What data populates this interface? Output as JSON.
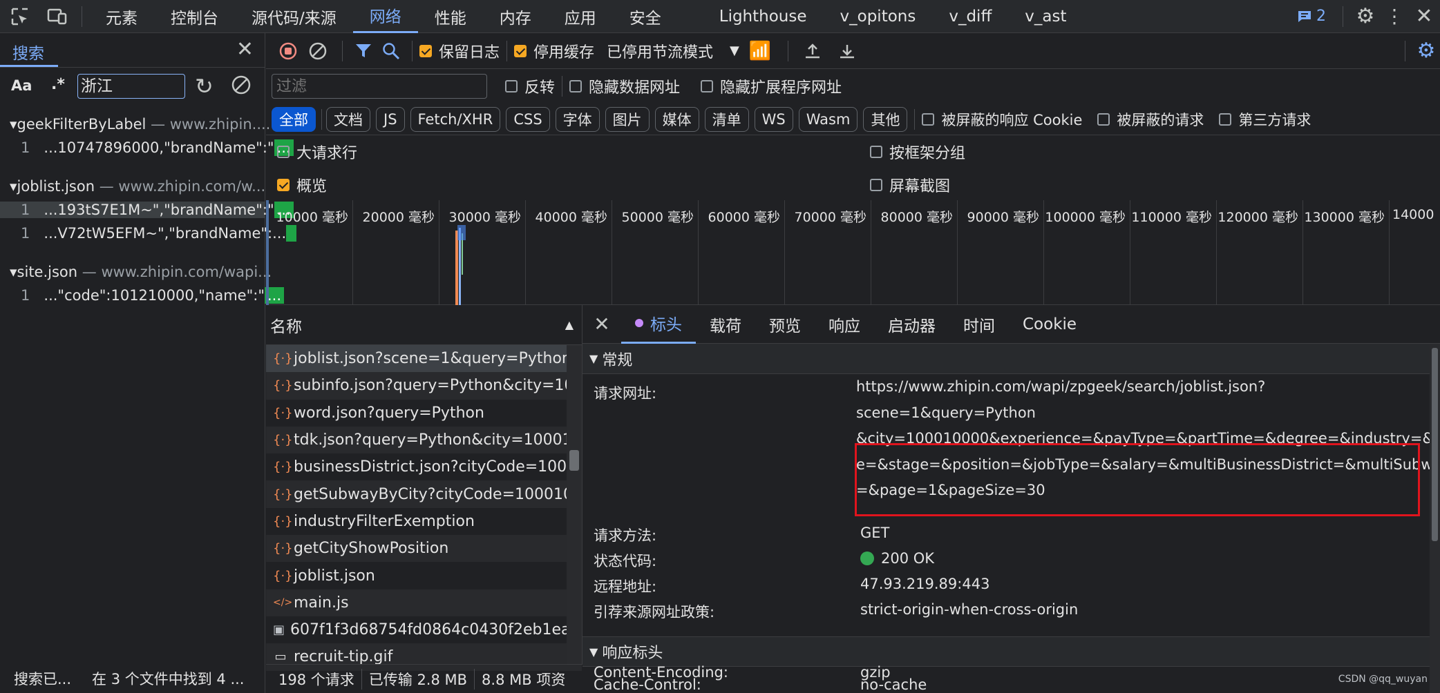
{
  "top_tabs": [
    "元素",
    "控制台",
    "源代码/来源",
    "网络",
    "性能",
    "内存",
    "应用",
    "安全",
    "Lighthouse",
    "v_opitons",
    "v_diff",
    "v_ast"
  ],
  "issues_count": "2",
  "search_panel": {
    "tab": "搜索",
    "case_label": "Aa",
    "regex_label": ".*",
    "query": "浙江",
    "results": [
      {
        "file": "geekFilterByLabel",
        "url": "— www.zhipin....",
        "lines": [
          {
            "num": "1",
            "text": "...10747896000,\"brandName\":\"",
            "hit": "..."
          }
        ]
      },
      {
        "file": "joblist.json",
        "url": "— www.zhipin.com/w...",
        "lines": [
          {
            "num": "1",
            "text": "...193tS7E1M~\",\"brandName\":\"",
            "hit": "..."
          },
          {
            "num": "1",
            "text": "...V72tW5EFM~\",\"brandName\":...",
            "hit": ""
          }
        ]
      },
      {
        "file": "site.json",
        "url": "— www.zhipin.com/wapi...",
        "lines": [
          {
            "num": "1",
            "text": "...\"code\":101210000,\"name\":\"",
            "hit": "..."
          }
        ]
      }
    ],
    "status_left": "搜索已...",
    "status_right": "在 3 个文件中找到 4 ..."
  },
  "toolbar": {
    "preserve_log": "保留日志",
    "disable_cache": "停用缓存",
    "throttle": "已停用节流模式"
  },
  "filter": {
    "placeholder": "过滤",
    "invert": "反转",
    "hide_data": "隐藏数据网址",
    "hide_ext": "隐藏扩展程序网址"
  },
  "types": [
    "全部",
    "文档",
    "JS",
    "Fetch/XHR",
    "CSS",
    "字体",
    "图片",
    "媒体",
    "清单",
    "WS",
    "Wasm",
    "其他"
  ],
  "blocked_cookies": "被屏蔽的响应 Cookie",
  "blocked_requests": "被屏蔽的请求",
  "third_party": "第三方请求",
  "options": {
    "big_rows": "大请求行",
    "group_by_frame": "按框架分组",
    "overview": "概览",
    "screenshots": "屏幕截图"
  },
  "timeline_ticks": [
    "10000 毫秒",
    "20000 毫秒",
    "30000 毫秒",
    "40000 毫秒",
    "50000 毫秒",
    "60000 毫秒",
    "70000 毫秒",
    "80000 毫秒",
    "90000 毫秒",
    "100000 毫秒",
    "110000 毫秒",
    "120000 毫秒",
    "130000 毫秒",
    "14000"
  ],
  "request_list": {
    "header": "名称",
    "items": [
      {
        "icon": "{·}",
        "name": "joblist.json?scene=1&query=Python..."
      },
      {
        "icon": "{·}",
        "name": "subinfo.json?query=Python&city=10..."
      },
      {
        "icon": "{·}",
        "name": "word.json?query=Python"
      },
      {
        "icon": "{·}",
        "name": "tdk.json?query=Python&city=10001..."
      },
      {
        "icon": "{·}",
        "name": "businessDistrict.json?cityCode=1000..."
      },
      {
        "icon": "{·}",
        "name": "getSubwayByCity?cityCode=100010..."
      },
      {
        "icon": "{·}",
        "name": "industryFilterExemption"
      },
      {
        "icon": "{·}",
        "name": "getCityShowPosition"
      },
      {
        "icon": "{·}",
        "name": "joblist.json"
      },
      {
        "icon": "</>",
        "name": "main.js"
      },
      {
        "icon": "▣",
        "name": "607f1f3d68754fd0864c0430f2eb1eac..."
      },
      {
        "icon": "▭",
        "name": "recruit-tip.gif"
      }
    ],
    "status": {
      "count": "198 个请求",
      "transferred": "已传输 2.8 MB",
      "resources": "8.8 MB 项资"
    }
  },
  "detail": {
    "tabs": [
      "标头",
      "载荷",
      "预览",
      "响应",
      "启动器",
      "时间",
      "Cookie"
    ],
    "general_title": "常规",
    "general": {
      "url_key": "请求网址:",
      "url_lines": [
        "https://www.zhipin.com/wapi/zpgeek/search/joblist.json?scene=1&query=Python",
        "&city=100010000&experience=&payType=&partTime=&degree=&industry=&scal",
        "e=&stage=&position=&jobType=&salary=&multiBusinessDistrict=&multiSubway",
        "=&page=1&pageSize=30"
      ],
      "method_key": "请求方法:",
      "method": "GET",
      "status_key": "状态代码:",
      "status": "200 OK",
      "remote_key": "远程地址:",
      "remote": "47.93.219.89:443",
      "referrer_key": "引荐来源网址政策:",
      "referrer": "strict-origin-when-cross-origin"
    },
    "response_title": "响应标头",
    "response": [
      {
        "key": "Cache-Control:",
        "value": "no-cache"
      },
      {
        "key": "Content-Encoding:",
        "value": "gzip"
      }
    ]
  },
  "watermark": "CSDN @qq_wuyan",
  "colors": {
    "accent": "#7cacf8",
    "selected_chip": "#0b57d0",
    "checkbox": "#f6a823",
    "highlight": "#e0141d",
    "match": "#1ea446"
  }
}
